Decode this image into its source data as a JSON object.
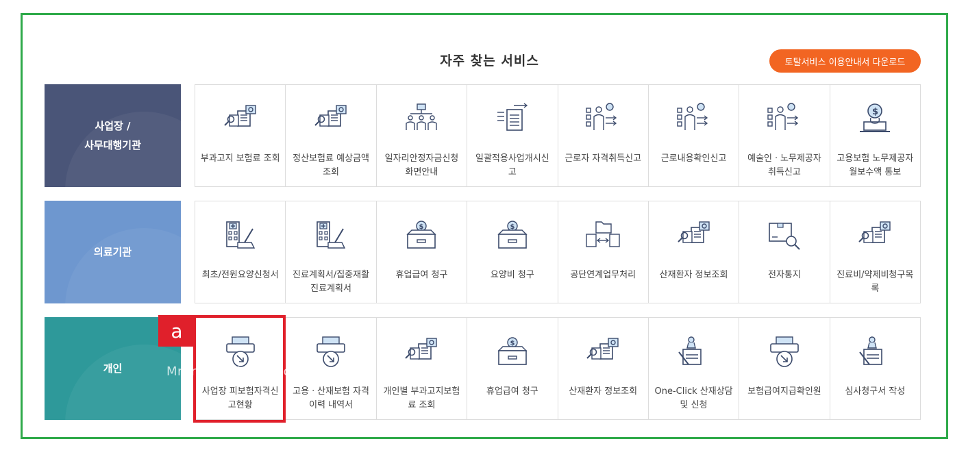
{
  "header": {
    "title": "자주 찾는 서비스",
    "download_button": "토탈서비스 이용안내서 다운로드"
  },
  "rows": [
    {
      "label": [
        "사업장 /",
        "사무대행기관"
      ],
      "color": "#4a5578",
      "items": [
        {
          "icon": "document-search-icon",
          "label": "부과고지 보험료 조회"
        },
        {
          "icon": "document-search-icon",
          "label": "정산보험료 예상금액 조회"
        },
        {
          "icon": "org-chart-icon",
          "label": "일자리안정자금신청화면안내"
        },
        {
          "icon": "document-arrows-icon",
          "label": "일괄적용사업개시신고"
        },
        {
          "icon": "person-checklist-icon",
          "label": "근로자 자격취득신고"
        },
        {
          "icon": "person-checklist-icon",
          "label": "근로내용확인신고"
        },
        {
          "icon": "person-checklist-icon",
          "label": "예술인ㆍ노무제공자 취득신고"
        },
        {
          "icon": "money-laptop-icon",
          "label": "고용보험 노무제공자 월보수액 통보"
        }
      ]
    },
    {
      "label": [
        "의료기관"
      ],
      "color": "#6e97cf",
      "items": [
        {
          "icon": "hospital-pen-icon",
          "label": "최초/전원요양신청서"
        },
        {
          "icon": "hospital-pen-icon",
          "label": "진료계획서/집중재활진료계획서"
        },
        {
          "icon": "coin-box-icon",
          "label": "휴업급여 청구"
        },
        {
          "icon": "coin-box-icon",
          "label": "요양비 청구"
        },
        {
          "icon": "folder-exchange-icon",
          "label": "공단연계업무처리"
        },
        {
          "icon": "document-search-icon",
          "label": "산재환자 정보조회"
        },
        {
          "icon": "parcel-search-icon",
          "label": "전자통지"
        },
        {
          "icon": "document-search-icon",
          "label": "진료비/약제비청구목록"
        }
      ]
    },
    {
      "label": [
        "개인"
      ],
      "color": "#2e999a",
      "items": [
        {
          "icon": "printer-arrow-icon",
          "label": "사업장 피보험자격신고현황"
        },
        {
          "icon": "printer-arrow-icon",
          "label": "고용ㆍ산재보험 자격 이력 내역서"
        },
        {
          "icon": "document-search-icon",
          "label": "개인별 부과고지보험료 조회"
        },
        {
          "icon": "coin-box-icon",
          "label": "휴업급여 청구"
        },
        {
          "icon": "document-search-icon",
          "label": "산재환자 정보조회"
        },
        {
          "icon": "stamp-document-icon",
          "label": "One-Click 산재상담 및 신청"
        },
        {
          "icon": "printer-arrow-icon",
          "label": "보험급여지급확인원"
        },
        {
          "icon": "stamp-document-icon",
          "label": "심사청구서 작성"
        }
      ]
    }
  ],
  "annotation": {
    "marker": "a"
  },
  "watermark": "Mrunom2.tistory.com"
}
